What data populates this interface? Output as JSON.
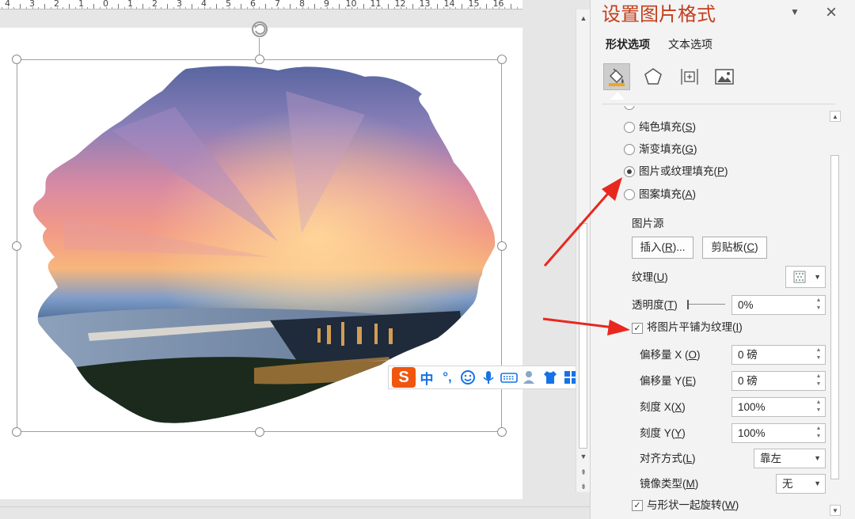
{
  "ruler": {
    "numbers": [
      "4",
      "3",
      "2",
      "1",
      "0",
      "1",
      "2",
      "3",
      "4",
      "5",
      "6",
      "7",
      "8",
      "9",
      "10",
      "11",
      "12",
      "13",
      "14",
      "15",
      "16"
    ]
  },
  "ime_toolbar": {
    "logo_label": "S",
    "chinese_mode_label": "中",
    "punctuation_label": "°,",
    "icons": [
      "smiley-icon",
      "microphone-icon",
      "keyboard-icon",
      "user-icon",
      "shirt-icon",
      "grid-icon"
    ]
  },
  "pane": {
    "title": "设置图片格式",
    "tabs": [
      {
        "label": "形状选项"
      },
      {
        "label": "文本选项"
      }
    ],
    "category_icons": [
      "fill-bucket-icon",
      "pentagon-icon",
      "size-layout-icon",
      "picture-icon"
    ],
    "fill_options": [
      {
        "label": "纯色填充(",
        "key": "S",
        "selected": false
      },
      {
        "label": "渐变填充(",
        "key": "G",
        "selected": false
      },
      {
        "label": "图片或纹理填充(",
        "key": "P",
        "selected": true
      },
      {
        "label": "图案填充(",
        "key": "A",
        "selected": false
      }
    ],
    "picture_source": {
      "heading": "图片源",
      "insert_label": "插入(",
      "insert_key": "R",
      "insert_suffix": ")...",
      "clipboard_label": "剪贴板(",
      "clipboard_key": "C"
    },
    "texture": {
      "label": "纹理(",
      "key": "U"
    },
    "transparency": {
      "label": "透明度(",
      "key": "T",
      "value": "0%",
      "level": 0
    },
    "tile_checkbox": {
      "label": "将图片平铺为纹理(",
      "key": "I",
      "checked": true
    },
    "offset_x": {
      "label": "偏移量 X (",
      "key": "O",
      "value": "0 磅"
    },
    "offset_y": {
      "label": "偏移量 Y(",
      "key": "E",
      "value": "0 磅"
    },
    "scale_x": {
      "label": "刻度 X(",
      "key": "X",
      "value": "100%"
    },
    "scale_y": {
      "label": "刻度 Y(",
      "key": "Y",
      "value": "100%"
    },
    "alignment": {
      "label": "对齐方式(",
      "key": "L",
      "value": "靠左"
    },
    "mirror_type": {
      "label": "镜像类型(",
      "key": "M",
      "value": "无"
    },
    "rotate_checkbox": {
      "label": "与形状一起旋转(",
      "key": "W",
      "checked": true
    }
  },
  "colors": {
    "pane_title": "#c43e1c",
    "annotation_arrow": "#e8281e",
    "ime_logo": "#f0560e",
    "ime_icons": "#1673e6"
  }
}
